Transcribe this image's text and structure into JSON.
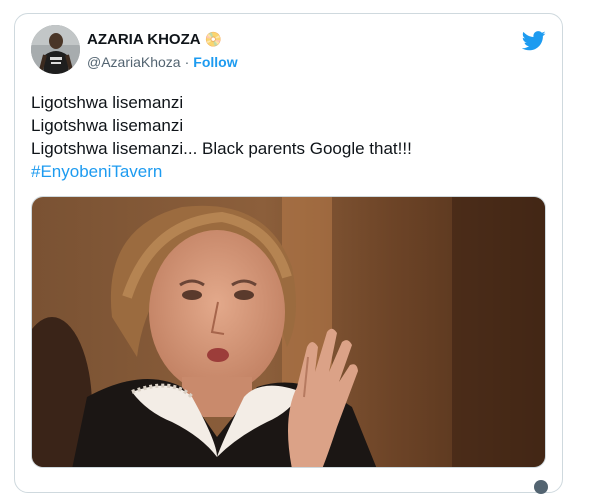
{
  "tweet": {
    "author": {
      "name": "AZARIA KHOZA",
      "name_emoji": "📀",
      "handle": "@AzariaKhoza",
      "separator": "·",
      "follow_label": "Follow"
    },
    "text_lines": [
      "Ligotshwa lisemanzi",
      "Ligotshwa lisemanzi",
      "Ligotshwa lisemanzi... Black parents Google that!!!"
    ],
    "hashtag": "#EnyobeniTavern",
    "icons": {
      "logo": "twitter-bird-icon",
      "avatar": "avatar-photo",
      "media": "judge-photo"
    },
    "colors": {
      "accent": "#1d9bf0",
      "text": "#0f1419",
      "muted": "#536471",
      "border": "#cfd9de"
    }
  }
}
